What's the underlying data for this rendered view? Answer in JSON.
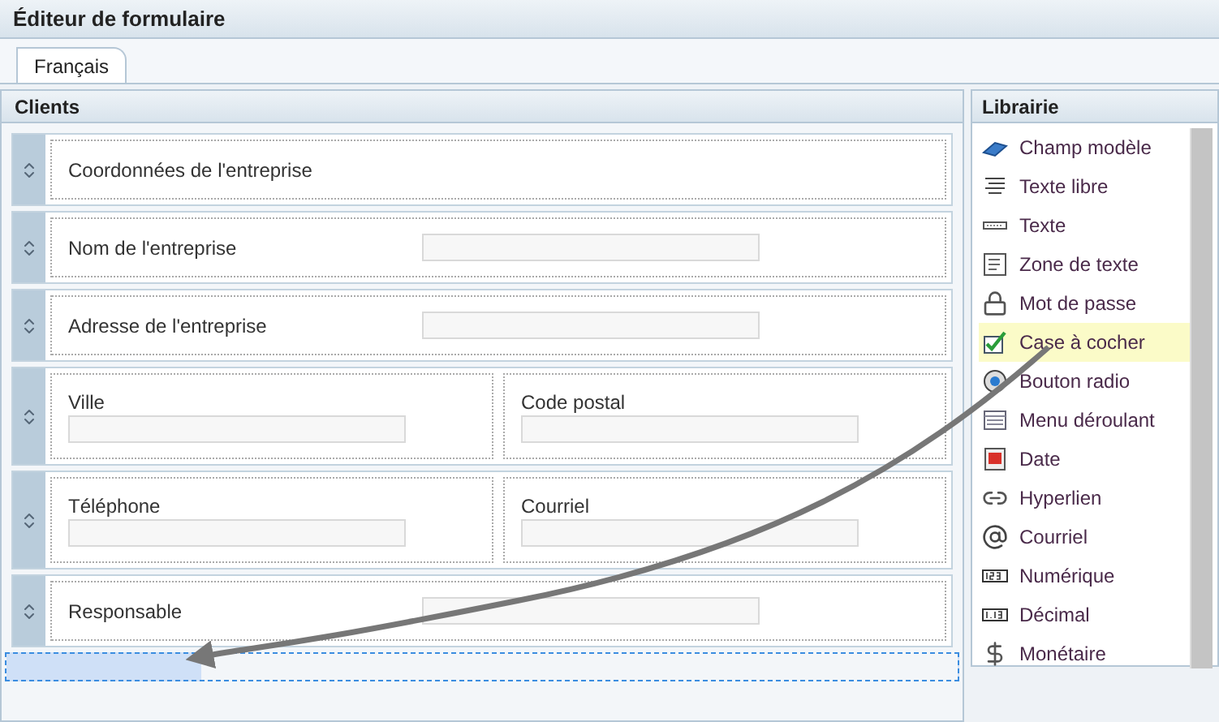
{
  "window": {
    "title": "Éditeur de formulaire"
  },
  "tabs": [
    {
      "label": "Français",
      "selected": true
    }
  ],
  "form": {
    "title": "Clients",
    "rows": [
      {
        "kind": "heading",
        "cells": [
          {
            "label": "Coordonnées de l'entreprise"
          }
        ]
      },
      {
        "kind": "inline",
        "cells": [
          {
            "label": "Nom de l'entreprise"
          }
        ]
      },
      {
        "kind": "inline",
        "cells": [
          {
            "label": "Adresse de l'entreprise"
          }
        ]
      },
      {
        "kind": "stacked",
        "cells": [
          {
            "label": "Ville"
          },
          {
            "label": "Code postal"
          }
        ]
      },
      {
        "kind": "stacked",
        "cells": [
          {
            "label": "Téléphone"
          },
          {
            "label": "Courriel"
          }
        ]
      },
      {
        "kind": "inline",
        "cells": [
          {
            "label": "Responsable"
          }
        ]
      }
    ],
    "drop_target": {
      "active": true
    }
  },
  "library": {
    "title": "Librairie",
    "items": [
      {
        "kind": "template",
        "label": "Champ modèle",
        "selected": false
      },
      {
        "kind": "freetext",
        "label": "Texte libre",
        "selected": false
      },
      {
        "kind": "text",
        "label": "Texte",
        "selected": false
      },
      {
        "kind": "textarea",
        "label": "Zone de texte",
        "selected": false
      },
      {
        "kind": "password",
        "label": "Mot de passe",
        "selected": false
      },
      {
        "kind": "checkbox",
        "label": "Case à cocher",
        "selected": true
      },
      {
        "kind": "radio",
        "label": "Bouton radio",
        "selected": false
      },
      {
        "kind": "dropdown",
        "label": "Menu déroulant",
        "selected": false
      },
      {
        "kind": "date",
        "label": "Date",
        "selected": false
      },
      {
        "kind": "link",
        "label": "Hyperlien",
        "selected": false
      },
      {
        "kind": "email",
        "label": "Courriel",
        "selected": false
      },
      {
        "kind": "number",
        "label": "Numérique",
        "selected": false
      },
      {
        "kind": "decimal",
        "label": "Décimal",
        "selected": false
      },
      {
        "kind": "currency",
        "label": "Monétaire",
        "selected": false
      }
    ]
  }
}
